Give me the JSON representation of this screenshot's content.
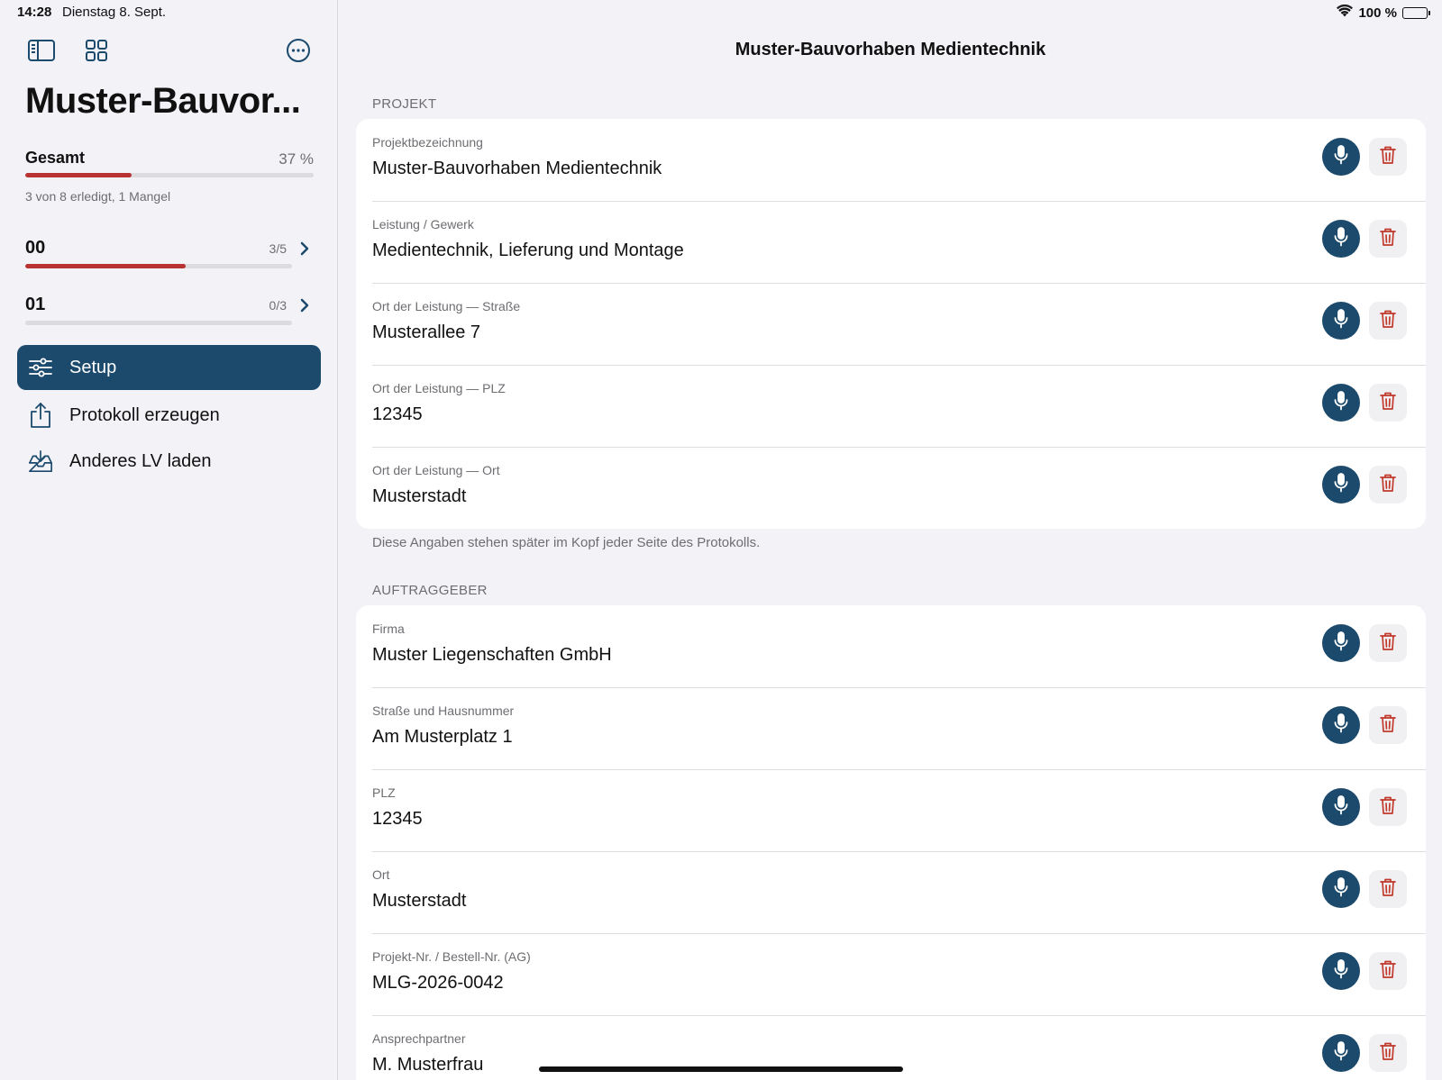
{
  "status_bar": {
    "time": "14:28",
    "date": "Dienstag 8. Sept.",
    "battery": "100 %"
  },
  "sidebar": {
    "title": "Muster-Bauvor...",
    "overall": {
      "label": "Gesamt",
      "percent_text": "37 %",
      "progress": 0.37,
      "note": "3 von 8 erledigt, 1 Mangel"
    },
    "sections": [
      {
        "label": "00",
        "count": "3/5",
        "progress": 0.6
      },
      {
        "label": "01",
        "count": "0/3",
        "progress": 0.0
      }
    ],
    "nav": [
      {
        "label": "Setup",
        "icon": "sliders-icon",
        "active": true
      },
      {
        "label": "Protokoll erzeugen",
        "icon": "share-icon",
        "active": false
      },
      {
        "label": "Anderes LV laden",
        "icon": "tray-download-icon",
        "active": false
      }
    ]
  },
  "main": {
    "title": "Muster-Bauvorhaben Medientechnik",
    "projekt": {
      "header": "PROJEKT",
      "footer": "Diese Angaben stehen später im Kopf jeder Seite des Protokolls.",
      "fields": [
        {
          "label": "Projektbezeichnung",
          "value": "Muster-Bauvorhaben Medientechnik"
        },
        {
          "label": "Leistung / Gewerk",
          "value": "Medientechnik, Lieferung und Montage"
        },
        {
          "label": "Ort der Leistung — Straße",
          "value": "Musterallee 7"
        },
        {
          "label": "Ort der Leistung — PLZ",
          "value": "12345"
        },
        {
          "label": "Ort der Leistung — Ort",
          "value": "Musterstadt"
        }
      ]
    },
    "auftraggeber": {
      "header": "AUFTRAGGEBER",
      "fields": [
        {
          "label": "Firma",
          "value": "Muster Liegenschaften GmbH"
        },
        {
          "label": "Straße und Hausnummer",
          "value": "Am Musterplatz 1"
        },
        {
          "label": "PLZ",
          "value": "12345"
        },
        {
          "label": "Ort",
          "value": "Musterstadt"
        },
        {
          "label": "Projekt-Nr. / Bestell-Nr. (AG)",
          "value": "MLG-2026-0042"
        },
        {
          "label": "Ansprechpartner",
          "value": "M. Musterfrau"
        }
      ]
    }
  },
  "colors": {
    "accent": "#1c4a6c",
    "progress": "#b83232",
    "delete": "#c0392b"
  }
}
